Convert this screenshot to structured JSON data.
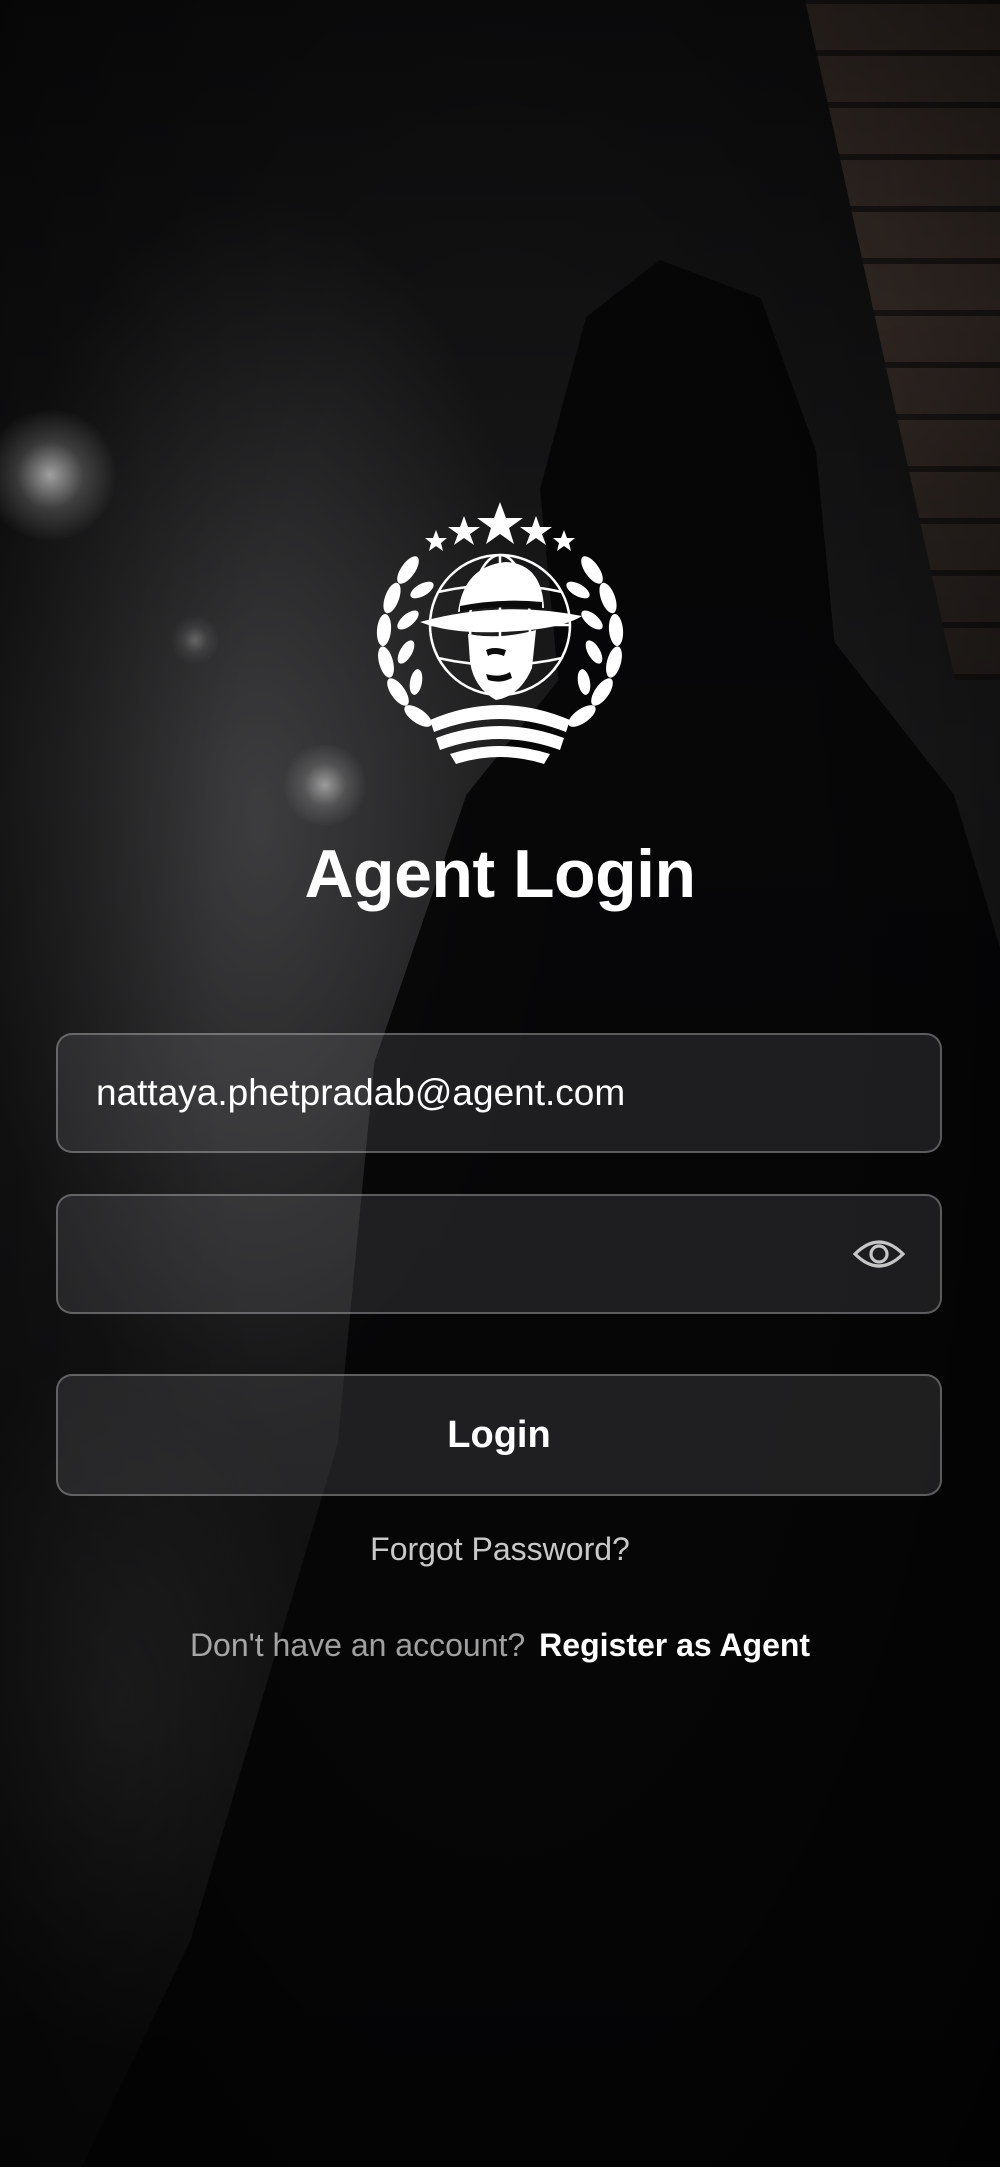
{
  "logo": {
    "icon": "agent-emblem-icon"
  },
  "title": "Agent Login",
  "email": {
    "value": "nattaya.phetpradab@agent.com",
    "placeholder": ""
  },
  "password": {
    "value": "",
    "placeholder": "",
    "toggle_icon": "eye-icon"
  },
  "login_label": "Login",
  "forgot_label": "Forgot Password?",
  "register": {
    "prompt": "Don't have an account?",
    "link": "Register as Agent"
  }
}
